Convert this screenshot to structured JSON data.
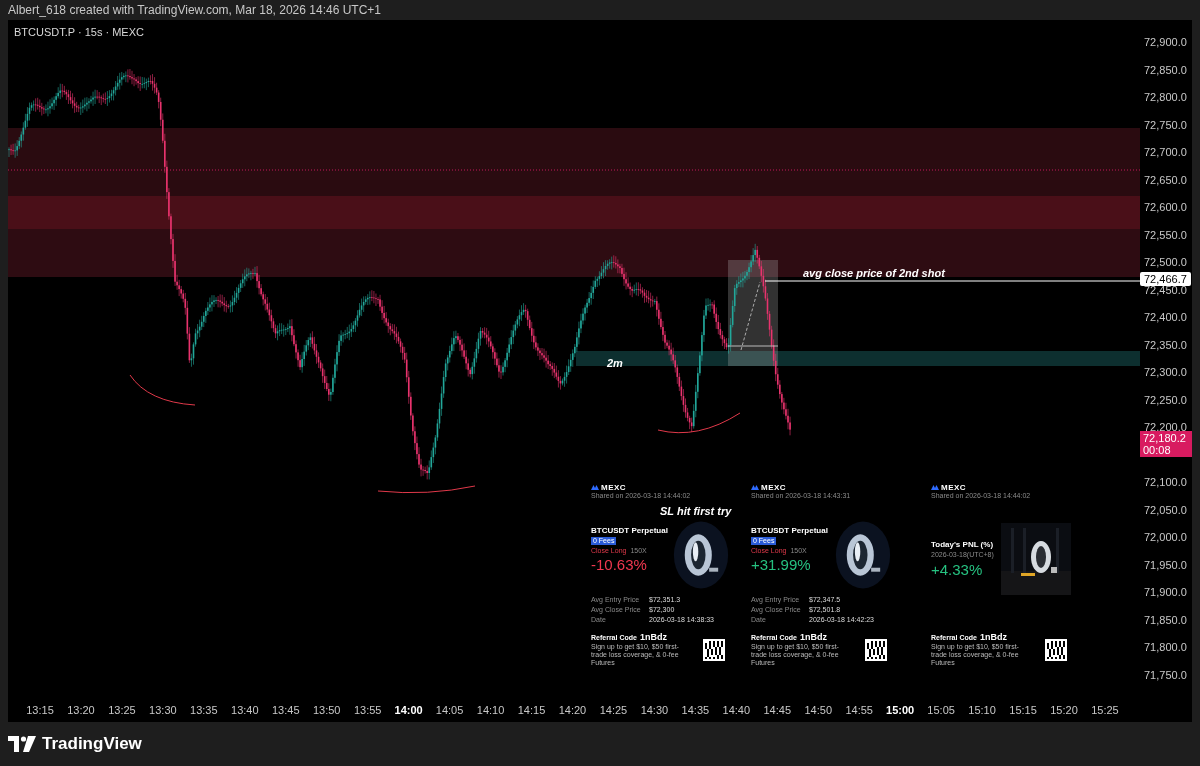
{
  "header": {
    "caption": "Albert_618 created with TradingView.com, Mar 18, 2026 14:46 UTC+1"
  },
  "chart": {
    "symbol": "BTCUSDT.P · 15s · MEXC",
    "price_axis": [
      "72,900.0",
      "72,850.0",
      "72,800.0",
      "72,750.0",
      "72,700.0",
      "72,650.0",
      "72,600.0",
      "72,550.0",
      "72,500.0",
      "72,450.0",
      "72,400.0",
      "72,350.0",
      "72,300.0",
      "72,250.0",
      "72,200.0",
      "72,100.0",
      "72,050.0",
      "72,000.0",
      "71,950.0",
      "71,900.0",
      "71,850.0",
      "71,800.0",
      "71,750.0"
    ],
    "time_axis": [
      {
        "label": "13:15",
        "kind": "minute"
      },
      {
        "label": "13:20",
        "kind": "minute"
      },
      {
        "label": "13:25",
        "kind": "minute"
      },
      {
        "label": "13:30",
        "kind": "minute"
      },
      {
        "label": "13:35",
        "kind": "minute"
      },
      {
        "label": "13:40",
        "kind": "minute"
      },
      {
        "label": "13:45",
        "kind": "minute"
      },
      {
        "label": "13:50",
        "kind": "minute"
      },
      {
        "label": "13:55",
        "kind": "minute"
      },
      {
        "label": "14:00",
        "kind": "hour"
      },
      {
        "label": "14:05",
        "kind": "minute"
      },
      {
        "label": "14:10",
        "kind": "minute"
      },
      {
        "label": "14:15",
        "kind": "minute"
      },
      {
        "label": "14:20",
        "kind": "minute"
      },
      {
        "label": "14:25",
        "kind": "minute"
      },
      {
        "label": "14:30",
        "kind": "minute"
      },
      {
        "label": "14:35",
        "kind": "minute"
      },
      {
        "label": "14:40",
        "kind": "minute"
      },
      {
        "label": "14:45",
        "kind": "minute"
      },
      {
        "label": "14:50",
        "kind": "minute"
      },
      {
        "label": "14:55",
        "kind": "minute"
      },
      {
        "label": "15:00",
        "kind": "hour"
      },
      {
        "label": "15:05",
        "kind": "minute"
      },
      {
        "label": "15:10",
        "kind": "minute"
      },
      {
        "label": "15:15",
        "kind": "minute"
      },
      {
        "label": "15:20",
        "kind": "minute"
      },
      {
        "label": "15:25",
        "kind": "minute"
      }
    ],
    "marked_price": "72,466.7",
    "last_price": {
      "price": "72,180.2",
      "countdown": "00:08"
    },
    "annotations": [
      {
        "text": "avg close price of 2nd shot"
      },
      {
        "text": "2m"
      },
      {
        "text": "SL hit first try"
      }
    ]
  },
  "cards": [
    {
      "kind": "position",
      "brand": "MEXC",
      "shared": "Shared on 2026-03-18 14:44:02",
      "pair": "BTCUSDT Perpetual",
      "badge": "0 Fees",
      "side": "Close Long",
      "leverage": "150X",
      "pnl": "-10.63%",
      "color": "#f0384f",
      "rows": [
        {
          "label": "Avg Entry Price",
          "value": "$72,351.3"
        },
        {
          "label": "Avg Close Price",
          "value": "$72,300"
        },
        {
          "label": "Date",
          "value": "2026-03-18 14:38:33"
        }
      ],
      "referral_label": "Referral Code",
      "referral_code": "1nBdz",
      "promo": "Sign up to get $10, $50 first-trade loss coverage, & 0-fee Futures"
    },
    {
      "kind": "position",
      "brand": "MEXC",
      "shared": "Shared on 2026-03-18 14:43:31",
      "pair": "BTCUSDT Perpetual",
      "badge": "0 Fees",
      "side": "Close Long",
      "leverage": "150X",
      "pnl": "+31.99%",
      "color": "#26c281",
      "rows": [
        {
          "label": "Avg Entry Price",
          "value": "$72,347.5"
        },
        {
          "label": "Avg Close Price",
          "value": "$72,501.8"
        },
        {
          "label": "Date",
          "value": "2026-03-18 14:42:23"
        }
      ],
      "referral_label": "Referral Code",
      "referral_code": "1nBdz",
      "promo": "Sign up to get $10, $50 first-trade loss coverage, & 0-fee Futures"
    },
    {
      "kind": "daily",
      "brand": "MEXC",
      "shared": "Shared on 2026-03-18 14:44:02",
      "title": "Today's PNL (%)",
      "date": "2026-03-18(UTC+8)",
      "pnl": "+4.33%",
      "color": "#26c281",
      "referral_label": "Referral Code",
      "referral_code": "1nBdz",
      "promo": "Sign up to get $10, $50 first-trade loss coverage, & 0-fee Futures"
    }
  ],
  "footer": {
    "brand": "TradingView"
  }
}
